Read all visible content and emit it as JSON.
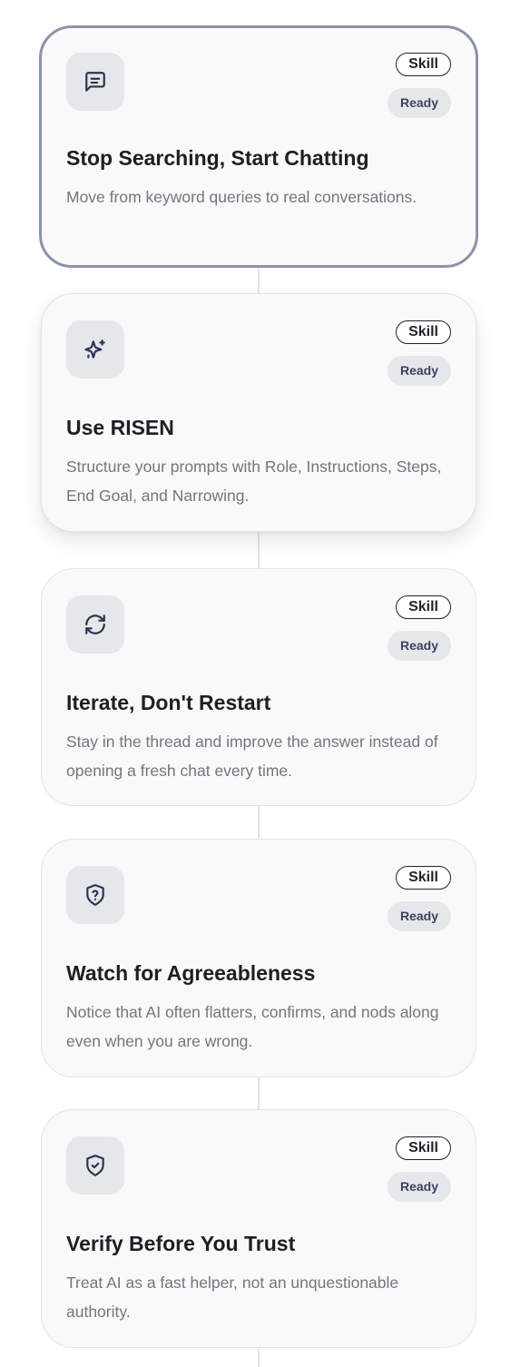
{
  "cards": [
    {
      "icon": "message-square-icon",
      "skill_label": "Skill",
      "status_label": "Ready",
      "title": "Stop Searching, Start Chatting",
      "description": "Move from keyword queries to real conversations."
    },
    {
      "icon": "sparkles-icon",
      "skill_label": "Skill",
      "status_label": "Ready",
      "title": "Use RISEN",
      "description": "Structure your prompts with Role, Instructions, Steps, End Goal, and Narrowing."
    },
    {
      "icon": "refresh-icon",
      "skill_label": "Skill",
      "status_label": "Ready",
      "title": "Iterate, Don't Restart",
      "description": "Stay in the thread and improve the answer instead of opening a fresh chat every time."
    },
    {
      "icon": "shield-question-icon",
      "skill_label": "Skill",
      "status_label": "Ready",
      "title": "Watch for Agreeableness",
      "description": "Notice that AI often flatters, confirms, and nods along even when you are wrong."
    },
    {
      "icon": "shield-check-icon",
      "skill_label": "Skill",
      "status_label": "Ready",
      "title": "Verify Before You Trust",
      "description": "Treat AI as a fast helper, not an unquestionable authority."
    }
  ]
}
